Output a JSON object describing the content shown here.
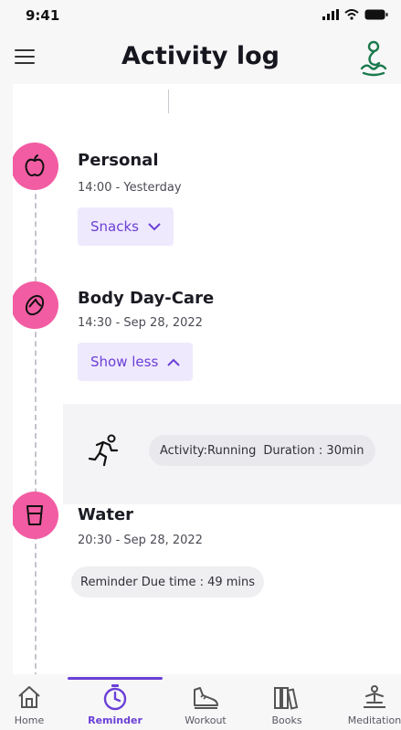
{
  "status_bar": {
    "time": "9:41"
  },
  "header": {
    "title": "Activity log"
  },
  "events": [
    {
      "title": "Personal",
      "time": "14:00 - Yesterday",
      "action_label": "Snacks",
      "icon": "apple-icon"
    },
    {
      "title": "Body Day-Care",
      "time": "14:30 - Sep 28, 2022",
      "action_label": "Show less",
      "icon": "flip-flop-icon"
    },
    {
      "title": "Water",
      "time": "20:30 - Sep 28, 2022",
      "icon": "glass-icon"
    }
  ],
  "details": {
    "activity": "Activity:Running",
    "duration": "Duration : 30min",
    "icon": "running-icon"
  },
  "reminder": {
    "text": "Reminder Due time : 49 mins"
  },
  "bottom_nav": {
    "items": [
      {
        "label": "Home",
        "icon": "home-icon"
      },
      {
        "label": "Reminder",
        "icon": "timer-icon"
      },
      {
        "label": "Workout",
        "icon": "shoe-icon"
      },
      {
        "label": "Books",
        "icon": "books-icon"
      },
      {
        "label": "Meditation",
        "icon": "meditation-icon"
      }
    ],
    "active": "Reminder"
  },
  "colors": {
    "accent": "#6a3fd6",
    "event_icon_bg": "#f25ca2",
    "chip_bg": "#efe9fd",
    "brand_green": "#1a7a4c"
  }
}
